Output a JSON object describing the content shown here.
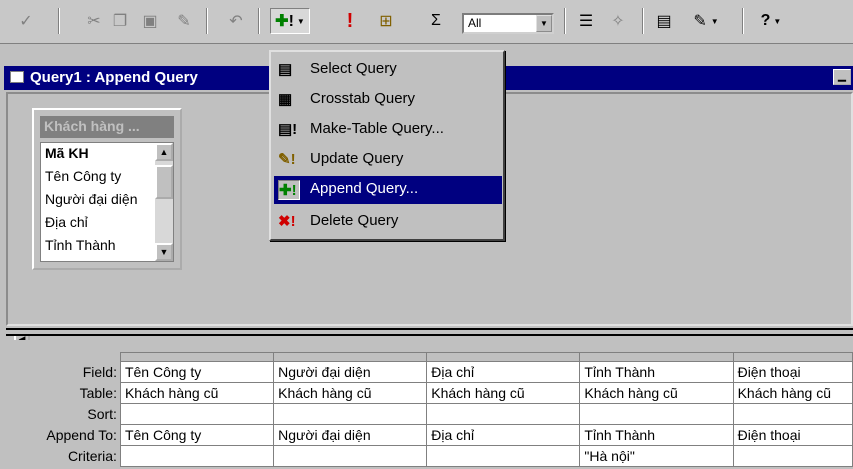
{
  "toolbar": {
    "icons": [
      "spelling-icon",
      "cut-icon",
      "copy-icon",
      "paste-icon",
      "format-painter-icon",
      "undo-icon",
      "query-type-icon",
      "run-icon",
      "show-table-icon",
      "totals-icon",
      "properties-icon",
      "build-icon",
      "database-window-icon",
      "new-object-icon",
      "help-icon"
    ],
    "top_values": "All"
  },
  "window": {
    "title": "Query1 : Append Query"
  },
  "table": {
    "title": "Khách hàng ...",
    "fields": [
      "Mã KH",
      "Tên Công ty",
      "Người đại diện",
      "Địa chỉ",
      "Tỉnh Thành"
    ]
  },
  "menu": {
    "items": [
      {
        "label": "Select Query",
        "icon": "select-query-icon",
        "glyph": "▤"
      },
      {
        "label": "Crosstab Query",
        "icon": "crosstab-query-icon",
        "glyph": "▦"
      },
      {
        "label": "Make-Table Query...",
        "icon": "make-table-query-icon",
        "glyph": "▤!"
      },
      {
        "label": "Update Query",
        "icon": "update-query-icon",
        "glyph": "✎!"
      },
      {
        "label": "Append Query...",
        "icon": "append-query-icon",
        "glyph": "✚!"
      },
      {
        "label": "Delete Query",
        "icon": "delete-query-icon",
        "glyph": "✖!"
      }
    ],
    "active_index": 4
  },
  "grid": {
    "row_labels": [
      "Field:",
      "Table:",
      "Sort:",
      "Append To:",
      "Criteria:"
    ],
    "columns": [
      {
        "field": "Tên Công ty",
        "table": "Khách hàng cũ",
        "sort": "",
        "append_to": "Tên Công ty",
        "criteria": ""
      },
      {
        "field": "Người đại diện",
        "table": "Khách hàng cũ",
        "sort": "",
        "append_to": "Người đại diện",
        "criteria": ""
      },
      {
        "field": "Địa chỉ",
        "table": "Khách hàng cũ",
        "sort": "",
        "append_to": "Địa chỉ",
        "criteria": ""
      },
      {
        "field": "Tỉnh Thành",
        "table": "Khách hàng cũ",
        "sort": "",
        "append_to": "Tỉnh Thành",
        "criteria": "\"Hà nội\""
      },
      {
        "field": "Điện thoại",
        "table": "Khách hàng cũ",
        "sort": "",
        "append_to": "Điện thoại",
        "criteria": ""
      }
    ]
  },
  "colors": {
    "title_bar": "#000080",
    "menu_highlight": "#000080",
    "face": "#c0c0c0"
  }
}
